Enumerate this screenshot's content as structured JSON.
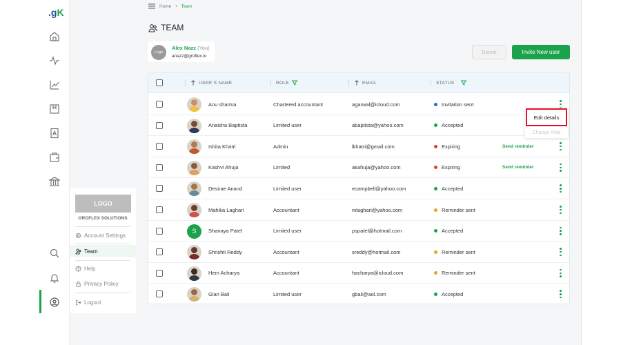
{
  "app": {
    "logo_text": "g",
    "logo_accent": "K"
  },
  "breadcrumb": {
    "home": "Home",
    "sep": "•",
    "current": "Team"
  },
  "page": {
    "title": "TEAM"
  },
  "current_user": {
    "avatar_text": "Logo",
    "name": "Alex Nazz",
    "you_tag": "(You)",
    "email": "anazz@groflex.io"
  },
  "actions": {
    "delete_label": "Delete",
    "invite_label": "Invite New user"
  },
  "panel": {
    "logo_label": "LOGO",
    "company": "GROFLEX SOLUTIONS",
    "items": {
      "account_settings": "Account Settings",
      "team": "Team",
      "help": "Help",
      "privacy_policy": "Privacy Policy",
      "logout": "Logout"
    }
  },
  "table": {
    "headers": {
      "name": "USER´S NAME",
      "role": "ROLE",
      "email": "EMAIL",
      "status": "STATUS"
    },
    "rows": [
      {
        "name": "Anu sharma",
        "role": "Chartered accountant",
        "email": "agarwal@icloud.com",
        "status": "Invitation sent",
        "status_color": "#1e6fd9",
        "action": ""
      },
      {
        "name": "Anaisha Baptista",
        "role": "Limited user",
        "email": "abaptista@yahoo.com",
        "status": "Accepted",
        "status_color": "#1aa34a",
        "action": ""
      },
      {
        "name": "Ishita Khatri",
        "role": "Admin",
        "email": "lkhatri@gmail.com",
        "status": "Expiring",
        "status_color": "#e03a3a",
        "action": "Send reminder"
      },
      {
        "name": "Kashvi Ahuja",
        "role": "Limited",
        "email": "akahuja@yahoo.com",
        "status": "Expiring",
        "status_color": "#e03a3a",
        "action": "Send reminder"
      },
      {
        "name": "Desirae Anand",
        "role": "Limited user",
        "email": "ecampbell@yahoo.com",
        "status": "Accepted",
        "status_color": "#1aa34a",
        "action": ""
      },
      {
        "name": "Mahika Laghari",
        "role": "Accountant",
        "email": "mlaghari@yahoo.com",
        "status": "Reminder sent",
        "status_color": "#f0a020",
        "action": ""
      },
      {
        "name": "Shanaya Patel",
        "role": "Limited user",
        "email": "pspatel@hotmail.com",
        "status": "Accepted",
        "status_color": "#1aa34a",
        "action": "",
        "avatar_letter": "S"
      },
      {
        "name": "Shrishti Reddy",
        "role": "Accountant",
        "email": "sreddy@hotmail.com",
        "status": "Reminder sent",
        "status_color": "#f0a020",
        "action": ""
      },
      {
        "name": "Hem Acharya",
        "role": "Accountant",
        "email": "hacharya@icloud.com",
        "status": "Reminder sent",
        "status_color": "#f0a020",
        "action": ""
      },
      {
        "name": "Gian Bali",
        "role": "Limited user",
        "email": "gbali@aol.com",
        "status": "Accepted",
        "status_color": "#1aa34a",
        "action": ""
      }
    ]
  },
  "row_menu": {
    "edit": "Edit details",
    "change_role": "Change Role"
  },
  "colors": {
    "accent": "#1aa34a",
    "highlight": "#e0102a"
  }
}
